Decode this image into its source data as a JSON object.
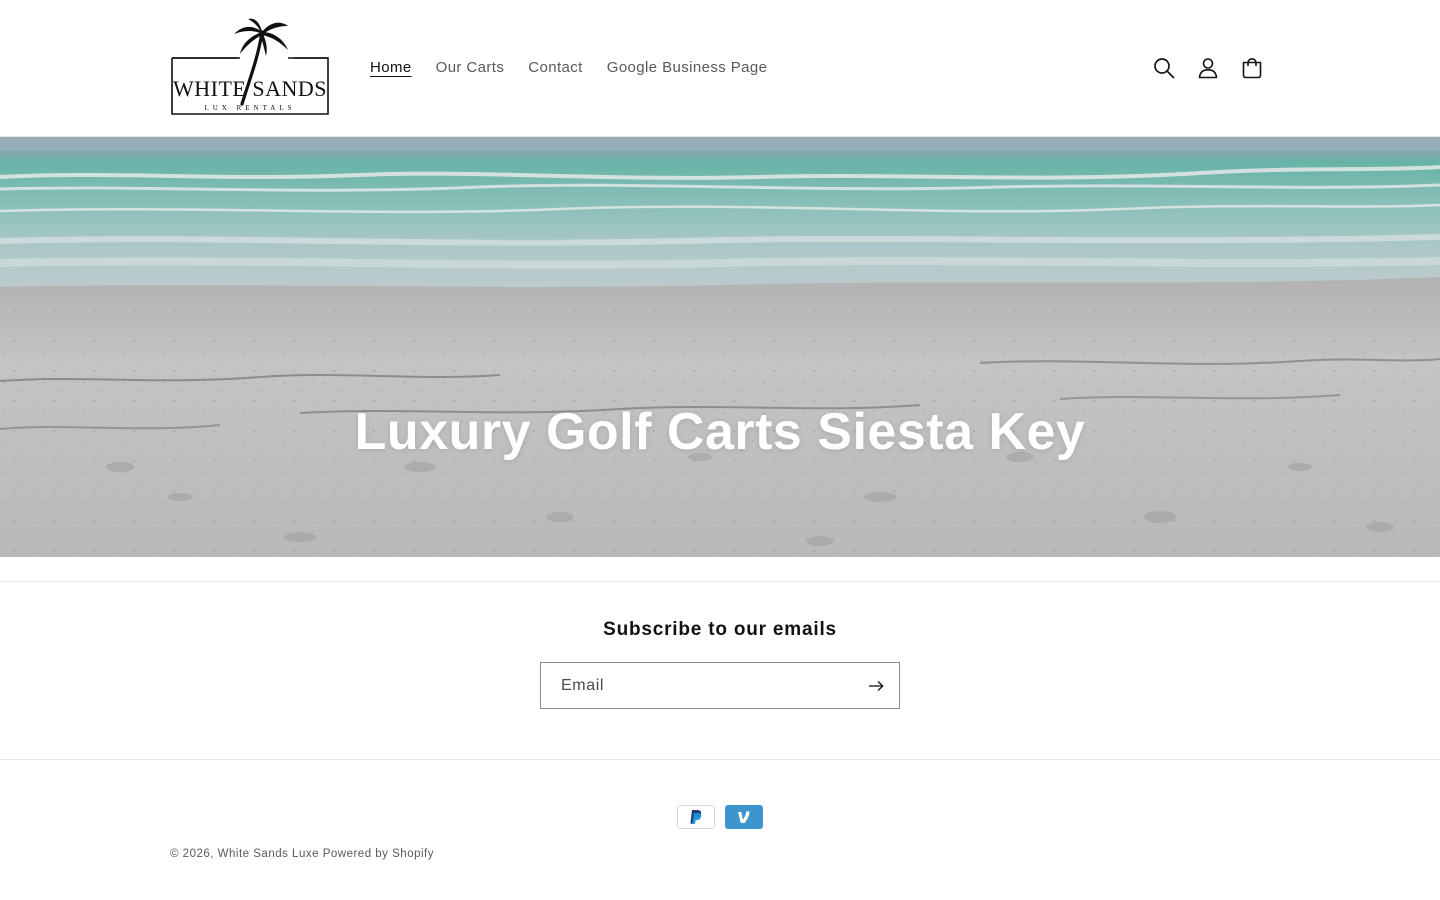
{
  "brand": {
    "logo_main": "WHITE SANDS",
    "logo_sub": "LUX RENTALS"
  },
  "nav": {
    "items": [
      {
        "label": "Home",
        "active": true
      },
      {
        "label": "Our Carts",
        "active": false
      },
      {
        "label": "Contact",
        "active": false
      },
      {
        "label": "Google Business Page",
        "active": false
      }
    ]
  },
  "header_icons": [
    "search-icon",
    "account-icon",
    "cart-icon"
  ],
  "hero": {
    "title": "Luxury Golf Carts Siesta Key"
  },
  "newsletter": {
    "heading": "Subscribe to our emails",
    "email_placeholder": "Email",
    "submit_icon": "arrow-right-icon"
  },
  "footer": {
    "payment_icons": [
      "paypal-icon",
      "venmo-icon"
    ],
    "copyright_prefix": "© 2026,",
    "store_name": "White Sands Luxe",
    "powered_by": "Powered by Shopify"
  },
  "colors": {
    "text": "#121212",
    "muted": "#595959",
    "border": "#e6e6e6",
    "venmo": "#3d95ce",
    "paypal_dark": "#253b80",
    "paypal_light": "#179bd7"
  }
}
